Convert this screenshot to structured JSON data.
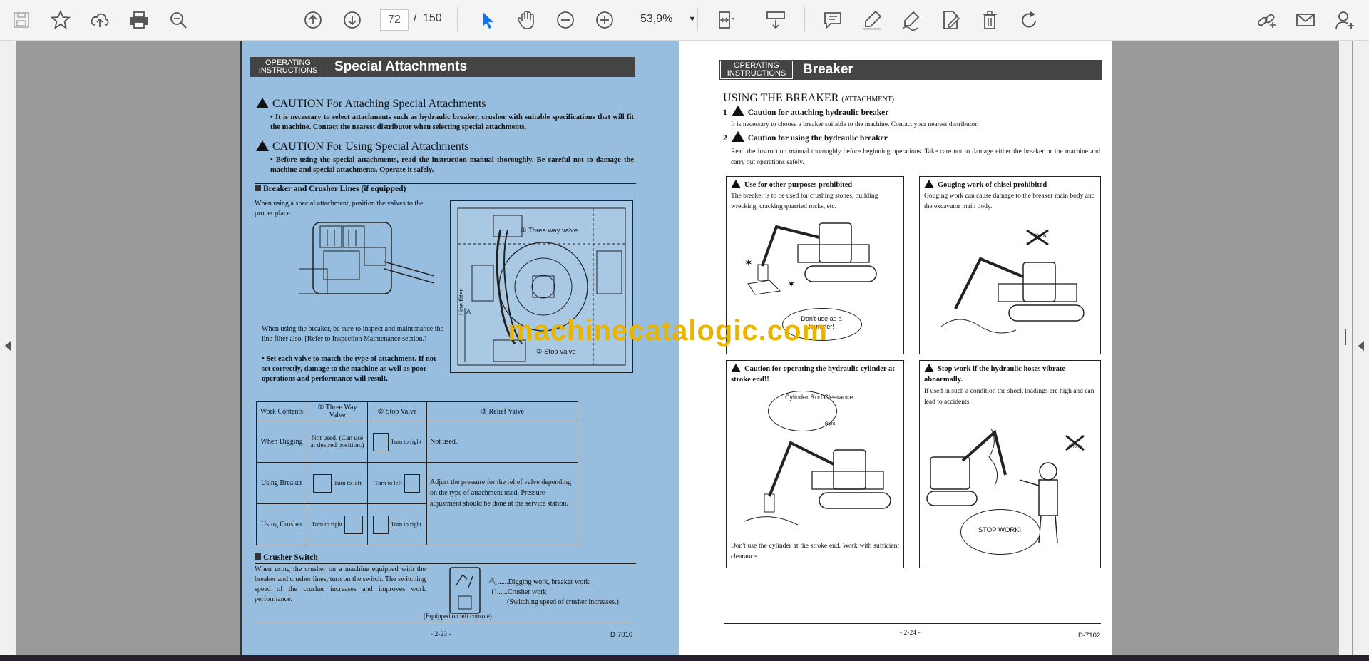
{
  "toolbar": {
    "page_current": "72",
    "page_sep": "/",
    "page_total": "150",
    "zoom": "53,9%",
    "icons": [
      "save-icon",
      "star-icon",
      "upload-icon",
      "print-icon",
      "zoom-search-icon",
      "page-up-icon",
      "page-down-icon",
      "cursor-icon",
      "hand-icon",
      "zoom-out-icon",
      "zoom-in-icon",
      "fit-page-icon",
      "scroll-mode-icon",
      "comment-icon",
      "highlight-icon",
      "sign-icon",
      "edit-pdf-icon",
      "delete-icon",
      "rotate-icon",
      "share-link-icon",
      "email-icon",
      "add-user-icon"
    ]
  },
  "left_page": {
    "header_tag": "OPERATING INSTRUCTIONS",
    "header_title": "Special Attachments",
    "caution1_title": "CAUTION For Attaching Special Attachments",
    "caution1_text": "• It is necessary to select attachments such as hydraulic breaker, crusher with suitable specifications that will fit the machine. Contact the nearest distributor when selecting special attachments.",
    "caution2_title": "CAUTION For Using Special Attachments",
    "caution2_text": "• Before using the special attachments, read the instruction manual thoroughly. Be careful not to damage the machine and special attachments. Operate it safely.",
    "section1_title": "Breaker and Crusher Lines (if equipped)",
    "section1_text": "When using a special attachment, position the valves to the proper place.",
    "label_three_way": "① Three way valve",
    "label_stop": "② Stop valve",
    "label_line_filter": "Line filter",
    "label_a": "A",
    "breaker_note": "When using the breaker, be sure to inspect and maintenance the line filter also. [Refer to Inspection Maintenance section.]",
    "bullet_note": "• Set each valve to match the type of attachment. If not set correctly, damage to the machine as well as poor operations and performance will result.",
    "table": {
      "head": [
        "Work Contents",
        "① Three Way Valve",
        "② Stop Valve",
        "③ Relief Valve"
      ],
      "rows": [
        {
          "work": "When Digging",
          "three": "Not used. (Can use at desired position.)",
          "stop": "Turn to right",
          "relief": "Not used."
        },
        {
          "work": "Using Breaker",
          "three": "Turn to left",
          "stop": "Turn to left",
          "relief": "Adjust the pressure for the relief valve depending on the type of attachment used. Pressure adjustment should be done at the service station."
        },
        {
          "work": "Using Crusher",
          "three": "Turn to right",
          "stop": "Turn to right",
          "relief": ""
        }
      ]
    },
    "section2_title": "Crusher Switch",
    "section2_text": "When using the crusher on a machine equipped with the breaker and crusher lines, turn on the switch. The switching speed of the crusher increases and improves work performance.",
    "switch_line1": "......Digging work, breaker work",
    "switch_line2": "......Crusher work",
    "switch_line3": "(Switching speed of crusher increases.)",
    "switch_caption": "(Equipped on left console)",
    "page_num": "- 2-23 -",
    "code": "D-7010"
  },
  "right_page": {
    "header_tag": "OPERATING INSTRUCTIONS",
    "header_title": "Breaker",
    "main_title": "USING THE BREAKER",
    "main_title_sub": "(ATTACHMENT)",
    "item1_num": "1",
    "item1_title": "Caution for attaching hydraulic breaker",
    "item1_text": "It is necessary to choose a breaker suitable to the machine. Contact your nearest distributor.",
    "item2_num": "2",
    "item2_title": "Caution for using the hydraulic breaker",
    "item2_text": "Read the instruction manual thoroughly before beginning operations. Take care not to damage either the breaker or the machine and carry out operations safely.",
    "boxes": [
      {
        "title": "Use for other purposes prohibited",
        "text": "The breaker is to be used for crushing stones, building wrecking, cracking quarried rocks, etc.",
        "bubble": "Don't use as a hammer!"
      },
      {
        "title": "Gouging work of chisel prohibited",
        "text": "Gouging work can cause damage to the breaker main body and the excavator main body.",
        "bubble": "Wrong"
      },
      {
        "title": "Caution for operating the hydraulic cylinder at stroke end!!",
        "text": "Don't use the cylinder at the stroke end. Work with sufficient clearance.",
        "bubble": "Cylinder Rod Clearance"
      },
      {
        "title": "Stop work if the hydraulic hoses vibrate abnormally.",
        "text": "If used in such a condition the shock loadings are high and can lead to accidents.",
        "bubble": "STOP WORK!"
      }
    ],
    "wrong_label": "Wrong",
    "right_label": "Right",
    "page_num": "- 2-24 -",
    "code": "D-7102"
  },
  "watermark": "machinecatalogic.com",
  "colors": {
    "left_page_bg": "#97bedf",
    "header_bg": "#444444",
    "watermark": "#e8b400",
    "viewer_bg": "#9a9a9a"
  }
}
